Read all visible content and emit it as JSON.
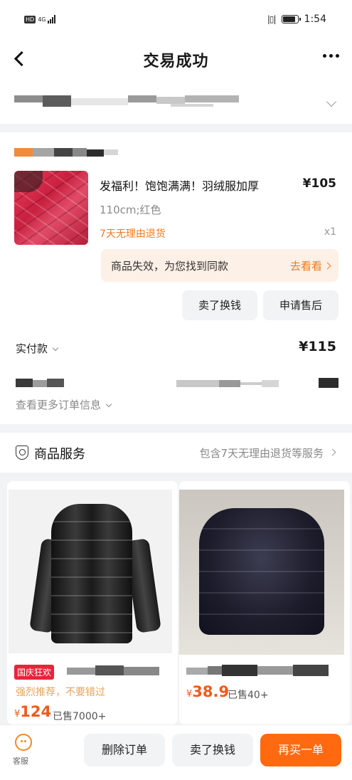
{
  "status_bar": {
    "hd": "HD",
    "network": "4G",
    "time": "1:54"
  },
  "header": {
    "title": "交易成功"
  },
  "order": {
    "product_title": "发福利！饱饱满满！羽绒服加厚",
    "price": "¥105",
    "spec": "110cm;红色",
    "return_policy": "7天无理由退货",
    "quantity": "x1",
    "notice_text": "商品失效，为您找到同款",
    "notice_link": "去看看",
    "btn_sell": "卖了换钱",
    "btn_aftersale": "申请售后",
    "paid_label": "实付款",
    "paid_value": "¥115",
    "more_info": "查看更多订单信息"
  },
  "service": {
    "label": "商品服务",
    "desc": "包含7天无理由退货等服务"
  },
  "recommendations": [
    {
      "badge": "国庆狂欢",
      "subtitle": "强烈推荐，不要错过",
      "currency": "¥",
      "price": "124",
      "sold": "已售7000+"
    },
    {
      "currency": "¥",
      "price": "38.9",
      "sold": "已售40+"
    }
  ],
  "bottom_bar": {
    "service_label": "客服",
    "btn_delete": "删除订单",
    "btn_sell": "卖了换钱",
    "btn_rebuy": "再买一单"
  },
  "colors": {
    "accent": "#ff6a10",
    "orange_text": "#f07a18",
    "badge_red": "#e8243c"
  }
}
